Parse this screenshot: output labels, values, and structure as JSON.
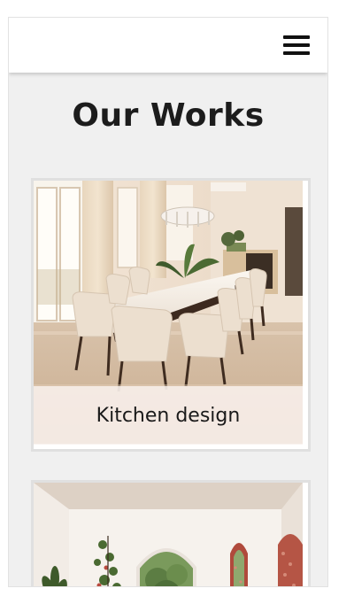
{
  "header": {
    "menu_icon": "hamburger-menu-icon"
  },
  "main": {
    "title": "Our Works",
    "works": [
      {
        "caption": "Kitchen design",
        "image": "dining-room-photo"
      },
      {
        "caption": "",
        "image": "arched-interior-photo"
      }
    ]
  },
  "colors": {
    "background": "#f0f0f0",
    "header": "#ffffff",
    "text": "#1c1c1c"
  }
}
